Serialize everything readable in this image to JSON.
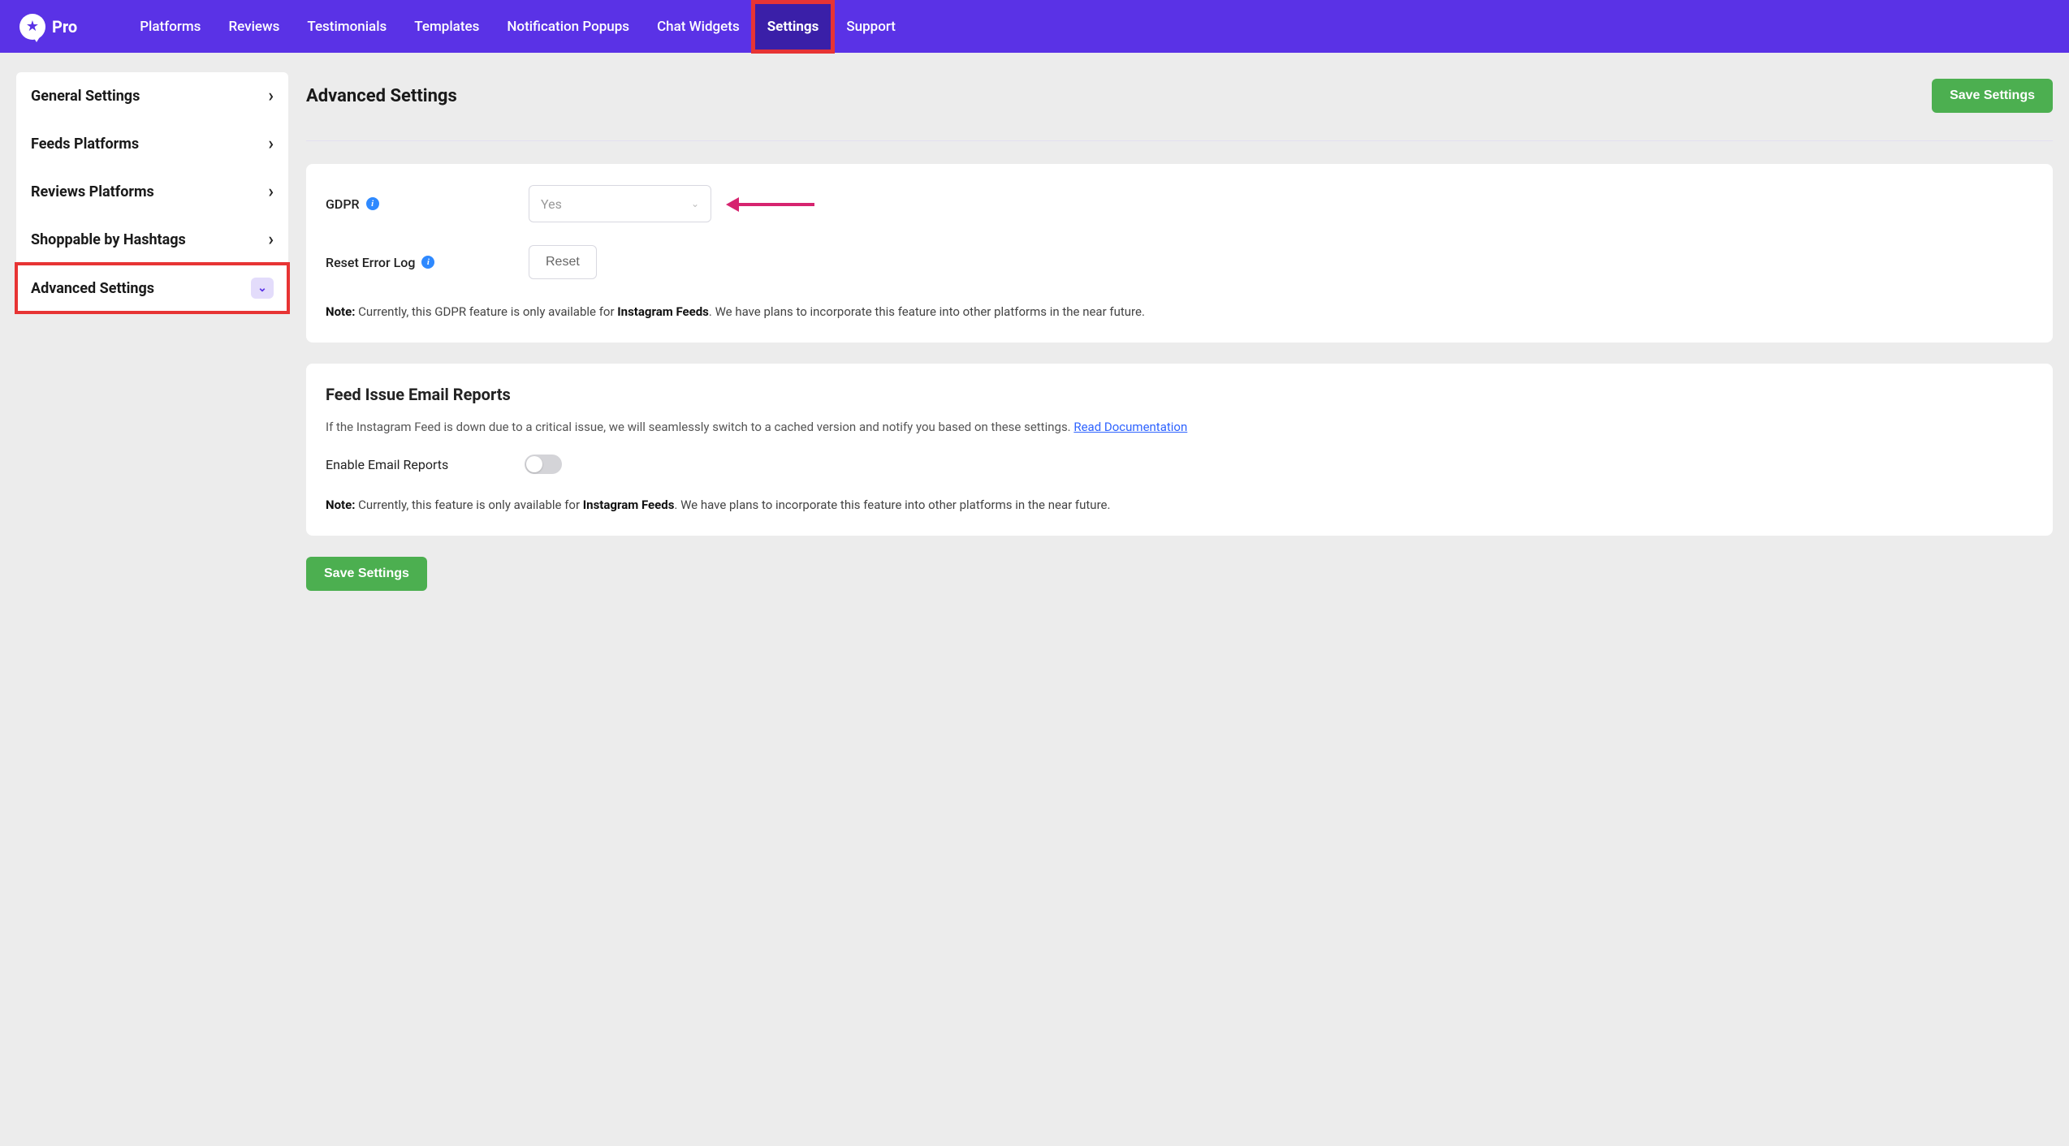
{
  "brand": {
    "name": "Pro"
  },
  "nav": {
    "items": [
      {
        "label": "Platforms",
        "active": false
      },
      {
        "label": "Reviews",
        "active": false
      },
      {
        "label": "Testimonials",
        "active": false
      },
      {
        "label": "Templates",
        "active": false
      },
      {
        "label": "Notification Popups",
        "active": false
      },
      {
        "label": "Chat Widgets",
        "active": false
      },
      {
        "label": "Settings",
        "active": true,
        "highlight": true
      },
      {
        "label": "Support",
        "active": false
      }
    ]
  },
  "sidebar": {
    "items": [
      {
        "label": "General Settings",
        "expanded": false
      },
      {
        "label": "Feeds Platforms",
        "expanded": false
      },
      {
        "label": "Reviews Platforms",
        "expanded": false
      },
      {
        "label": "Shoppable by Hashtags",
        "expanded": false
      },
      {
        "label": "Advanced Settings",
        "expanded": true,
        "highlight": true
      }
    ]
  },
  "page": {
    "title": "Advanced Settings",
    "save_label": "Save Settings"
  },
  "gdpr_section": {
    "gdpr_label": "GDPR",
    "gdpr_value": "Yes",
    "reset_label": "Reset Error Log",
    "reset_button": "Reset",
    "note_prefix": "Note:",
    "note_text_1": " Currently, this GDPR feature is only available for ",
    "note_bold": "Instagram Feeds",
    "note_text_2": ". We have plans to incorporate this feature into other platforms in the near future."
  },
  "email_section": {
    "heading": "Feed Issue Email Reports",
    "desc_1": "If the Instagram Feed is down due to a critical issue, we will seamlessly switch to a cached version and notify you based on these settings. ",
    "link_text": "Read Documentation",
    "enable_label": "Enable Email Reports",
    "enabled": false,
    "note_prefix": "Note:",
    "note_text_1": " Currently, this feature is only available for ",
    "note_bold": "Instagram Feeds",
    "note_text_2": ". We have plans to incorporate this feature into other platforms in the near future."
  }
}
